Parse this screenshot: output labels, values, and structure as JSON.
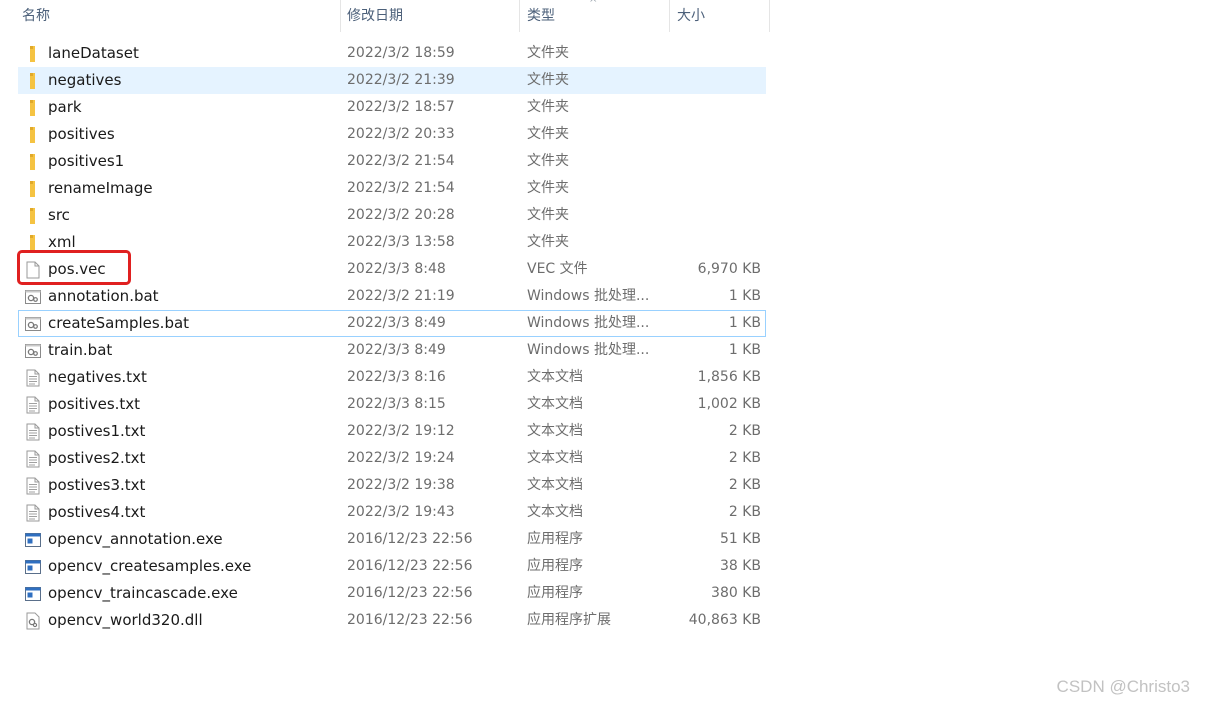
{
  "columns": {
    "name": "名称",
    "date": "修改日期",
    "type": "类型",
    "size": "大小"
  },
  "colors": {
    "folder": "#f5c342",
    "selected_bg": "#e5f3ff",
    "focus_border": "#99d1ff",
    "highlight": "#e02020"
  },
  "files": [
    {
      "name": "laneDataset",
      "date": "2022/3/2 18:59",
      "type": "文件夹",
      "size": "",
      "icon": "folder-icon"
    },
    {
      "name": "negatives",
      "date": "2022/3/2 21:39",
      "type": "文件夹",
      "size": "",
      "icon": "folder-icon"
    },
    {
      "name": "park",
      "date": "2022/3/2 18:57",
      "type": "文件夹",
      "size": "",
      "icon": "folder-icon"
    },
    {
      "name": "positives",
      "date": "2022/3/2 20:33",
      "type": "文件夹",
      "size": "",
      "icon": "folder-icon"
    },
    {
      "name": "positives1",
      "date": "2022/3/2 21:54",
      "type": "文件夹",
      "size": "",
      "icon": "folder-icon"
    },
    {
      "name": "renameImage",
      "date": "2022/3/2 21:54",
      "type": "文件夹",
      "size": "",
      "icon": "folder-icon"
    },
    {
      "name": "src",
      "date": "2022/3/2 20:28",
      "type": "文件夹",
      "size": "",
      "icon": "folder-icon"
    },
    {
      "name": "xml",
      "date": "2022/3/3 13:58",
      "type": "文件夹",
      "size": "",
      "icon": "folder-icon"
    },
    {
      "name": "pos.vec",
      "date": "2022/3/3 8:48",
      "type": "VEC 文件",
      "size": "6,970 KB",
      "icon": "file-icon"
    },
    {
      "name": "annotation.bat",
      "date": "2022/3/2 21:19",
      "type": "Windows 批处理...",
      "size": "1 KB",
      "icon": "batch-file-icon"
    },
    {
      "name": "createSamples.bat",
      "date": "2022/3/3 8:49",
      "type": "Windows 批处理...",
      "size": "1 KB",
      "icon": "batch-file-icon"
    },
    {
      "name": "train.bat",
      "date": "2022/3/3 8:49",
      "type": "Windows 批处理...",
      "size": "1 KB",
      "icon": "batch-file-icon"
    },
    {
      "name": "negatives.txt",
      "date": "2022/3/3 8:16",
      "type": "文本文档",
      "size": "1,856 KB",
      "icon": "text-file-icon"
    },
    {
      "name": "positives.txt",
      "date": "2022/3/3 8:15",
      "type": "文本文档",
      "size": "1,002 KB",
      "icon": "text-file-icon"
    },
    {
      "name": "postives1.txt",
      "date": "2022/3/2 19:12",
      "type": "文本文档",
      "size": "2 KB",
      "icon": "text-file-icon"
    },
    {
      "name": "postives2.txt",
      "date": "2022/3/2 19:24",
      "type": "文本文档",
      "size": "2 KB",
      "icon": "text-file-icon"
    },
    {
      "name": "postives3.txt",
      "date": "2022/3/2 19:38",
      "type": "文本文档",
      "size": "2 KB",
      "icon": "text-file-icon"
    },
    {
      "name": "postives4.txt",
      "date": "2022/3/2 19:43",
      "type": "文本文档",
      "size": "2 KB",
      "icon": "text-file-icon"
    },
    {
      "name": "opencv_annotation.exe",
      "date": "2016/12/23 22:56",
      "type": "应用程序",
      "size": "51 KB",
      "icon": "executable-icon"
    },
    {
      "name": "opencv_createsamples.exe",
      "date": "2016/12/23 22:56",
      "type": "应用程序",
      "size": "38 KB",
      "icon": "executable-icon"
    },
    {
      "name": "opencv_traincascade.exe",
      "date": "2016/12/23 22:56",
      "type": "应用程序",
      "size": "380 KB",
      "icon": "executable-icon"
    },
    {
      "name": "opencv_world320.dll",
      "date": "2016/12/23 22:56",
      "type": "应用程序扩展",
      "size": "40,863 KB",
      "icon": "dll-file-icon"
    }
  ],
  "watermark": "CSDN @Christo3"
}
